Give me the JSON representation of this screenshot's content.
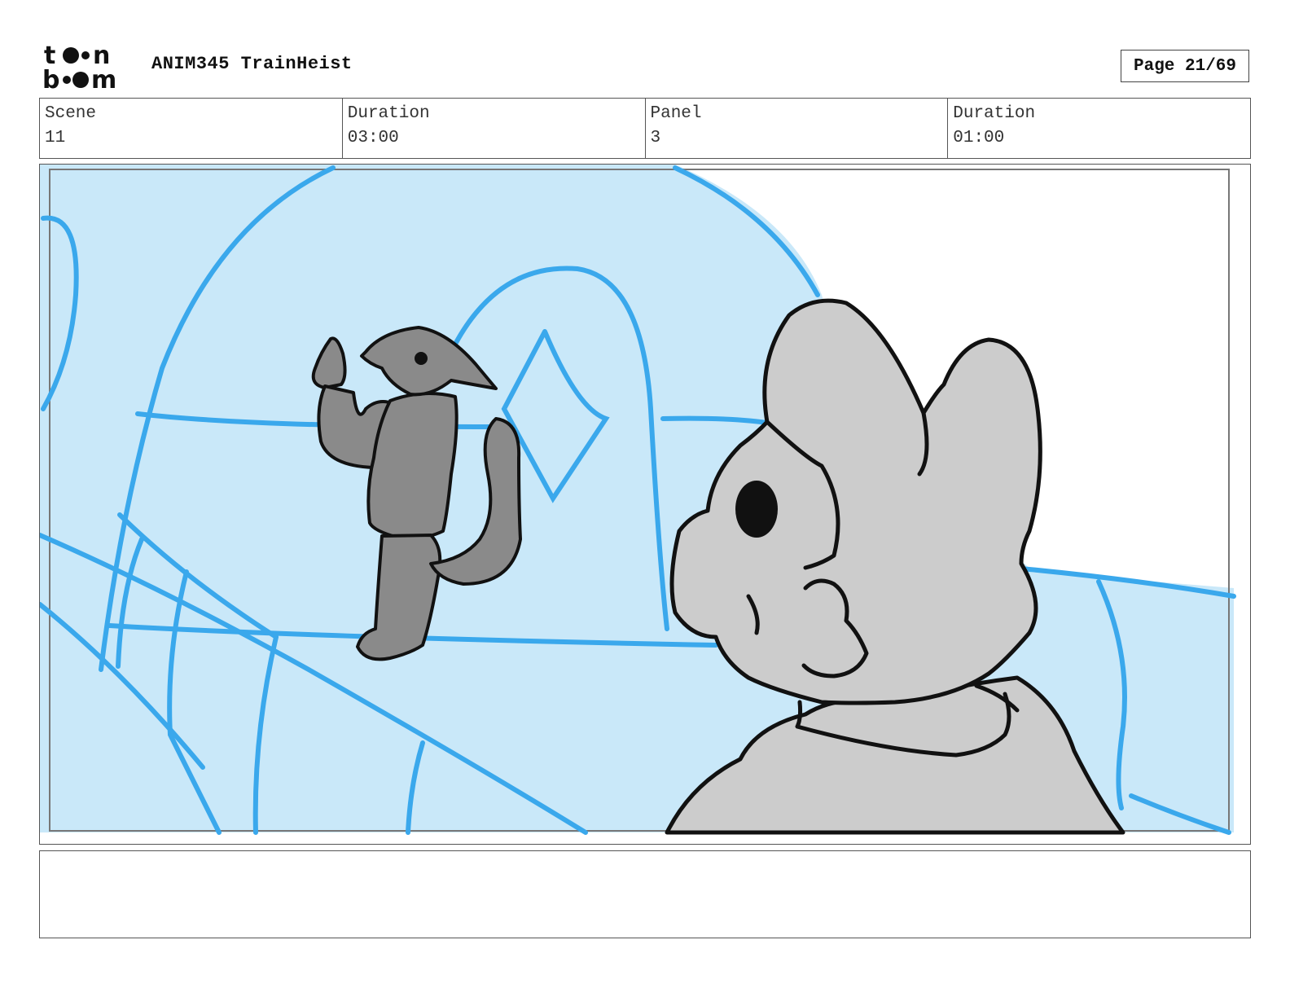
{
  "header": {
    "logo_text_top": "toon",
    "logo_text_bottom": "boom",
    "title": "ANIM345 TrainHeist",
    "page_label": "Page 21/69"
  },
  "info": {
    "scene_label": "Scene",
    "scene_value": "11",
    "scene_duration_label": "Duration",
    "scene_duration_value": "03:00",
    "panel_label": "Panel",
    "panel_value": "3",
    "panel_duration_label": "Duration",
    "panel_duration_value": "01:00"
  },
  "panel": {
    "colors": {
      "sky_fill": "#c9e8f9",
      "sketch_blue": "#3aa8ec",
      "character_fill": "#cccccc",
      "character_dark_fill": "#8a8a8a",
      "ink": "#111111"
    }
  },
  "notes": {
    "text": ""
  }
}
